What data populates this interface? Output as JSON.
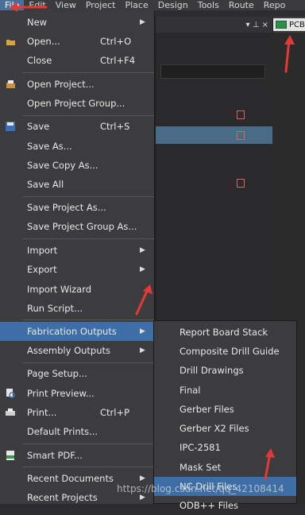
{
  "menubar": {
    "items": [
      {
        "label": "File",
        "active": true
      },
      {
        "label": "Edit"
      },
      {
        "label": "View"
      },
      {
        "label": "Project"
      },
      {
        "label": "Place"
      },
      {
        "label": "Design"
      },
      {
        "label": "Tools"
      },
      {
        "label": "Route"
      },
      {
        "label": "Repo"
      }
    ]
  },
  "document_tab": {
    "label": "PCB"
  },
  "panel": {
    "pin_glyph": "▾ ⊥ ×"
  },
  "menu": {
    "items": [
      {
        "label": "New",
        "shortcut": "",
        "submenu": true,
        "icon": ""
      },
      {
        "label": "Open...",
        "shortcut": "Ctrl+O",
        "submenu": false,
        "icon": "folder-open-icon"
      },
      {
        "label": "Close",
        "shortcut": "Ctrl+F4",
        "submenu": false,
        "icon": ""
      },
      {
        "label": "Open Project...",
        "shortcut": "",
        "submenu": false,
        "icon": "open-project-icon"
      },
      {
        "label": "Open Project Group...",
        "shortcut": "",
        "submenu": false,
        "icon": ""
      },
      {
        "label": "Save",
        "shortcut": "Ctrl+S",
        "submenu": false,
        "icon": "save-icon"
      },
      {
        "label": "Save As...",
        "shortcut": "",
        "submenu": false,
        "icon": ""
      },
      {
        "label": "Save Copy As...",
        "shortcut": "",
        "submenu": false,
        "icon": ""
      },
      {
        "label": "Save All",
        "shortcut": "",
        "submenu": false,
        "icon": ""
      },
      {
        "label": "Save Project As...",
        "shortcut": "",
        "submenu": false,
        "icon": ""
      },
      {
        "label": "Save Project Group As...",
        "shortcut": "",
        "submenu": false,
        "icon": ""
      },
      {
        "label": "Import",
        "shortcut": "",
        "submenu": true,
        "icon": ""
      },
      {
        "label": "Export",
        "shortcut": "",
        "submenu": true,
        "icon": ""
      },
      {
        "label": "Import Wizard",
        "shortcut": "",
        "submenu": false,
        "icon": ""
      },
      {
        "label": "Run Script...",
        "shortcut": "",
        "submenu": false,
        "icon": ""
      },
      {
        "label": "Fabrication Outputs",
        "shortcut": "",
        "submenu": true,
        "icon": "",
        "highlighted": true
      },
      {
        "label": "Assembly Outputs",
        "shortcut": "",
        "submenu": true,
        "icon": ""
      },
      {
        "label": "Page Setup...",
        "shortcut": "",
        "submenu": false,
        "icon": ""
      },
      {
        "label": "Print Preview...",
        "shortcut": "",
        "submenu": false,
        "icon": "print-preview-icon"
      },
      {
        "label": "Print...",
        "shortcut": "Ctrl+P",
        "submenu": false,
        "icon": "printer-icon"
      },
      {
        "label": "Default Prints...",
        "shortcut": "",
        "submenu": false,
        "icon": ""
      },
      {
        "label": "Smart PDF...",
        "shortcut": "",
        "submenu": false,
        "icon": "pdf-icon"
      },
      {
        "label": "Recent Documents",
        "shortcut": "",
        "submenu": true,
        "icon": ""
      },
      {
        "label": "Recent Projects",
        "shortcut": "",
        "submenu": true,
        "icon": ""
      }
    ]
  },
  "submenu": {
    "items": [
      {
        "label": "Report Board Stack"
      },
      {
        "label": "Composite Drill Guide"
      },
      {
        "label": "Drill Drawings"
      },
      {
        "label": "Final"
      },
      {
        "label": "Gerber Files"
      },
      {
        "label": "Gerber X2 Files"
      },
      {
        "label": "IPC-2581"
      },
      {
        "label": "Mask Set"
      },
      {
        "label": "NC Drill Files",
        "highlighted": true
      },
      {
        "label": "ODB++ Files"
      }
    ]
  },
  "watermark": "https://blog.csdn.net/qq_42108414",
  "colors": {
    "accent": "#3d6fa6",
    "annotation": "#e53935"
  }
}
